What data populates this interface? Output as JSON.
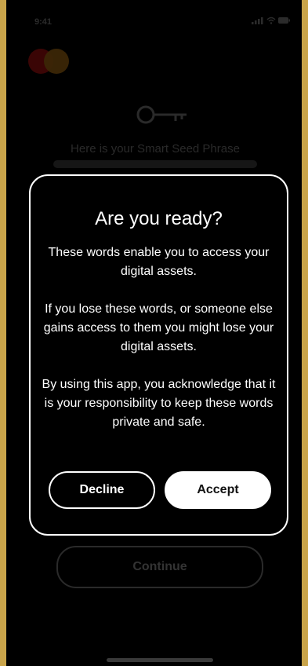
{
  "status_bar": {
    "time": "9:41",
    "icons": "signal wifi battery"
  },
  "background": {
    "heading": "Here is your Smart Seed Phrase",
    "continue_label": "Continue"
  },
  "modal": {
    "title": "Are you ready?",
    "paragraphs": [
      "These words enable you to access your digital assets.",
      "If you lose these words, or someone else gains access to them you might lose your digital assets.",
      "By using this app, you acknowledge that it is your responsibility to keep these words private and safe."
    ],
    "decline_label": "Decline",
    "accept_label": "Accept"
  },
  "colors": {
    "frame": "#c9a44a",
    "screen": "#000000",
    "modal_border": "#ffffff",
    "accept_bg": "#ffffff"
  }
}
